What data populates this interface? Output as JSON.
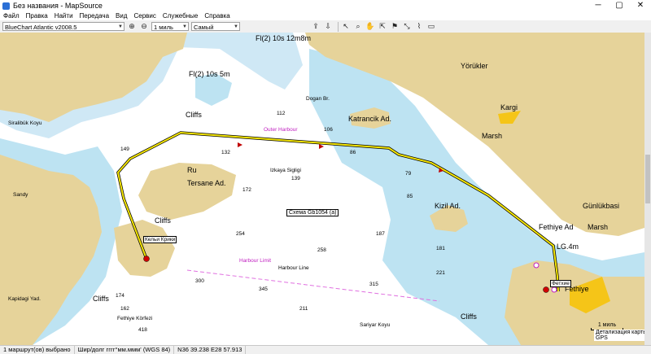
{
  "window": {
    "title": "Без названия - MapSource",
    "min": "─",
    "max": "▢",
    "close": "✕"
  },
  "menu": [
    "Файл",
    "Правка",
    "Найти",
    "Передача",
    "Вид",
    "Сервис",
    "Служебные",
    "Справка"
  ],
  "toolbar": {
    "product": "BlueChart Atlantic v2008.5",
    "zoom": "1 миль",
    "detail": "Самый высокий"
  },
  "map": {
    "tooltip": "Схема Gb1054 (а)",
    "scale_label": "1 миль",
    "detail_text": "Детализация карты GPS",
    "waypoints": {
      "start": "Кельи Крики",
      "end": "Фетхие"
    },
    "route_color": "#f5e600",
    "labels": {
      "yoruklar": "Yörükler",
      "kargi": "Kargi",
      "marsh1": "Marsh",
      "marsh2": "Marsh",
      "gunluk": "Günlükbasi",
      "katranci": "Katrancik Ad.",
      "kizil": "Kizil Ad.",
      "tersane": "Tersane Ad.",
      "ru": "Ru",
      "cliffs1": "Cliffs",
      "cliffs2": "Cliffs",
      "cliffs3": "Cliffs",
      "cliffs4": "Cliffs",
      "fethiye_ad": "Fethiye Ad",
      "fethiye": "Fethiye",
      "outer": "Outer Harbour",
      "limit": "Harbour Limit",
      "line": "Harbour Line",
      "fl1": "Fl(2) 10s 12m8m",
      "fl2": "Fl(2) 10s 5m",
      "lg": "LG.4m",
      "sandy": "Sandy",
      "dogan": "Dogan Br.",
      "izkaya": "Izkaya Sigligi",
      "saryar": "Sariyar Koyu",
      "fethiye_k": "Fethiye Körfezi",
      "kapidagi": "Kapidagi Yad.",
      "sirali": "Siralibük Koyu"
    },
    "depths": [
      "149",
      "112",
      "139",
      "132",
      "172",
      "254",
      "300",
      "345",
      "211",
      "258",
      "187",
      "181",
      "221",
      "106",
      "86",
      "79",
      "85",
      "418",
      "315",
      "174",
      "162"
    ]
  },
  "status": {
    "routes": "1 маршрут(ов) выбрано",
    "format": "Шир/долг гггг°мм.ммм' (WGS 84)",
    "coords": "N36 39.238 E28 57.913"
  }
}
